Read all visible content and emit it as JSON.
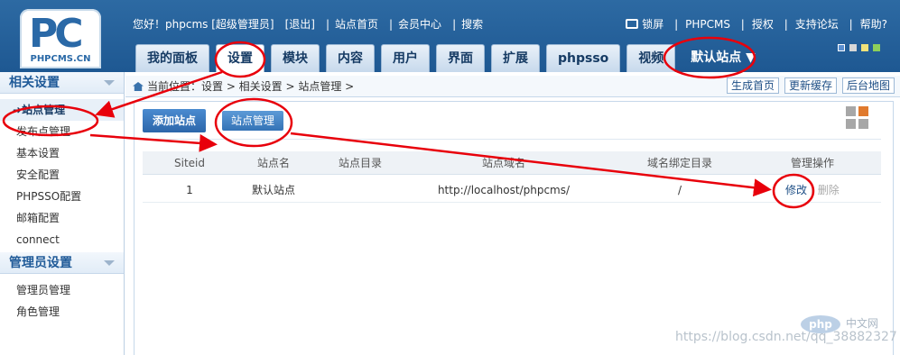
{
  "header": {
    "logo_text": "PC",
    "logo_sub": "PHPCMS.CN",
    "greeting": "您好！phpcms [超级管理员]",
    "logout": "[退出]",
    "links": [
      "站点首页",
      "会员中心",
      "搜索"
    ],
    "right_links": [
      "锁屏",
      "PHPCMS",
      "授权",
      "支持论坛",
      "帮助?"
    ],
    "theme_colors": [
      "#5a8fd0",
      "#d7d7d7",
      "#f0e27a",
      "#8dcf5a"
    ]
  },
  "nav": {
    "tabs": [
      "我的面板",
      "设置",
      "模块",
      "内容",
      "用户",
      "界面",
      "扩展",
      "phpsso",
      "视频"
    ],
    "active": "设置",
    "site_label": "默认站点"
  },
  "sidebar": {
    "section1": "相关设置",
    "items1": [
      "站点管理",
      "发布点管理",
      "基本设置",
      "安全配置",
      "PHPSSO配置",
      "邮箱配置",
      "connect"
    ],
    "section2": "管理员设置",
    "items2": [
      "管理员管理",
      "角色管理"
    ]
  },
  "breadcrumb": {
    "text": "当前位置：设置 > 相关设置 > 站点管理 >",
    "buttons": [
      "生成首页",
      "更新缓存",
      "后台地图"
    ]
  },
  "toolbar": {
    "add_label": "添加站点",
    "manage_label": "站点管理"
  },
  "table": {
    "headers": [
      "Siteid",
      "站点名",
      "站点目录",
      "站点域名",
      "域名绑定目录",
      "管理操作"
    ],
    "rows": [
      {
        "siteid": "1",
        "name": "默认站点",
        "dir": "",
        "domain": "http://localhost/phpcms/",
        "bind_dir": "/",
        "edit": "修改",
        "sep": "|",
        "delete": "删除"
      }
    ]
  },
  "watermark": {
    "url": "https://blog.csdn.net/qq_38882327",
    "php": "php",
    "cn": "中文网"
  },
  "annotation_color": "#e8000b"
}
